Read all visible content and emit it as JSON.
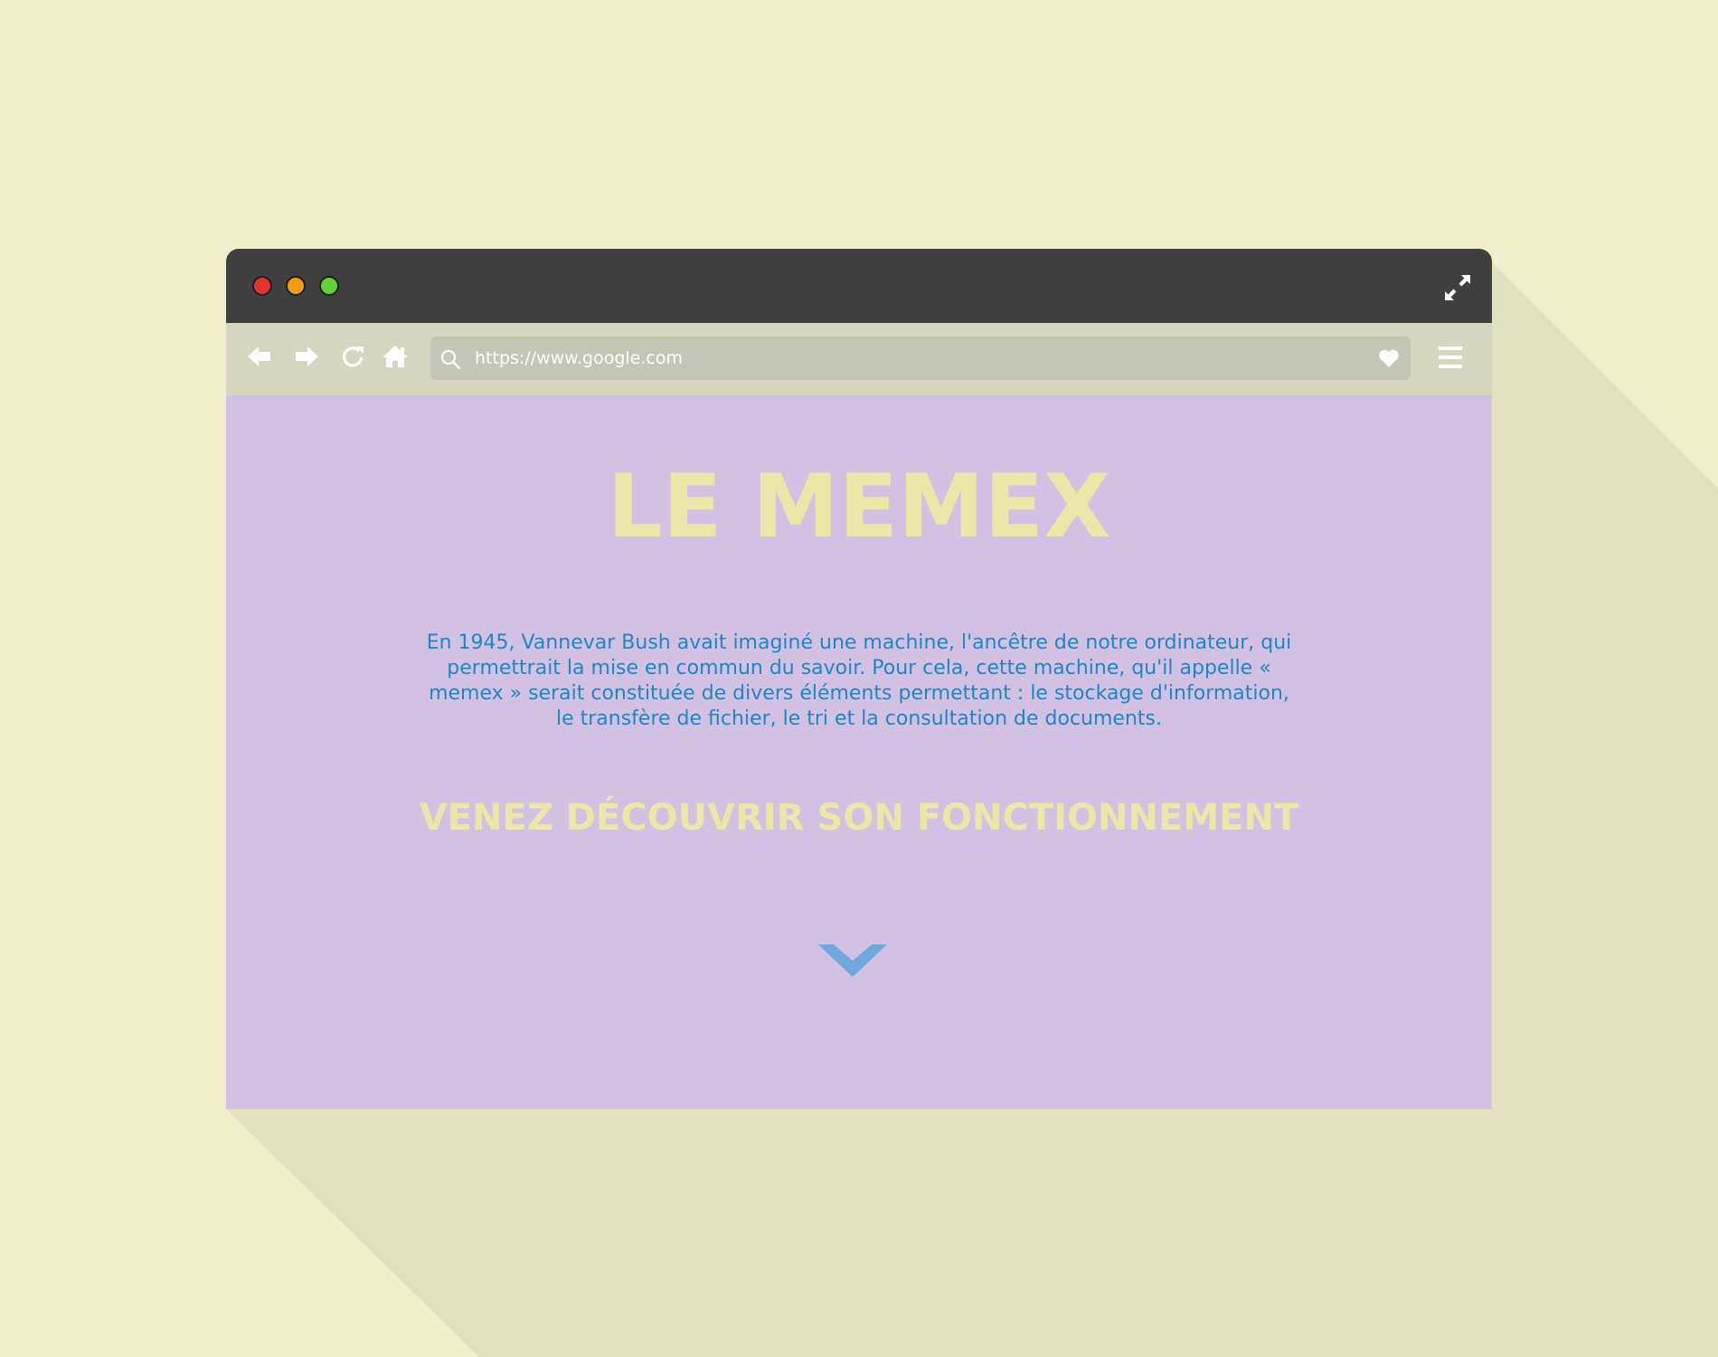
{
  "colors": {
    "background": "#f1eecb",
    "titlebar": "#404040",
    "toolbar": "#d6d5bf",
    "urlbar": "#c4c6b6",
    "content": "#d2c1e3",
    "title": "#ece6a8",
    "body_text": "#1f86c6",
    "chevron": "#6fa9dc",
    "close": "#e2342e",
    "minimize": "#f39c12",
    "maximize": "#5fd13a"
  },
  "window": {
    "controls": [
      "close",
      "minimize",
      "maximize"
    ],
    "fullscreen_icon": "expand-arrows"
  },
  "toolbar": {
    "nav_icons": [
      "arrow-left",
      "arrow-right",
      "reload",
      "home"
    ],
    "url": "https://www.google.com",
    "favorite_icon": "heart",
    "menu_icon": "hamburger"
  },
  "page": {
    "title": "LE MEMEX",
    "intro": "En 1945, Vannevar Bush avait imaginé une machine, l'ancêtre de notre ordinateur, qui permettrait la mise en commun du savoir. Pour cela, cette machine, qu'il appelle « memex » serait constituée de divers éléments permettant : le stockage d'information, le transfère de fichier, le tri et la consultation de documents.",
    "subtitle": "VENEZ DÉCOUVRIR SON FONCTIONNEMENT",
    "scroll_icon": "chevron-down"
  }
}
